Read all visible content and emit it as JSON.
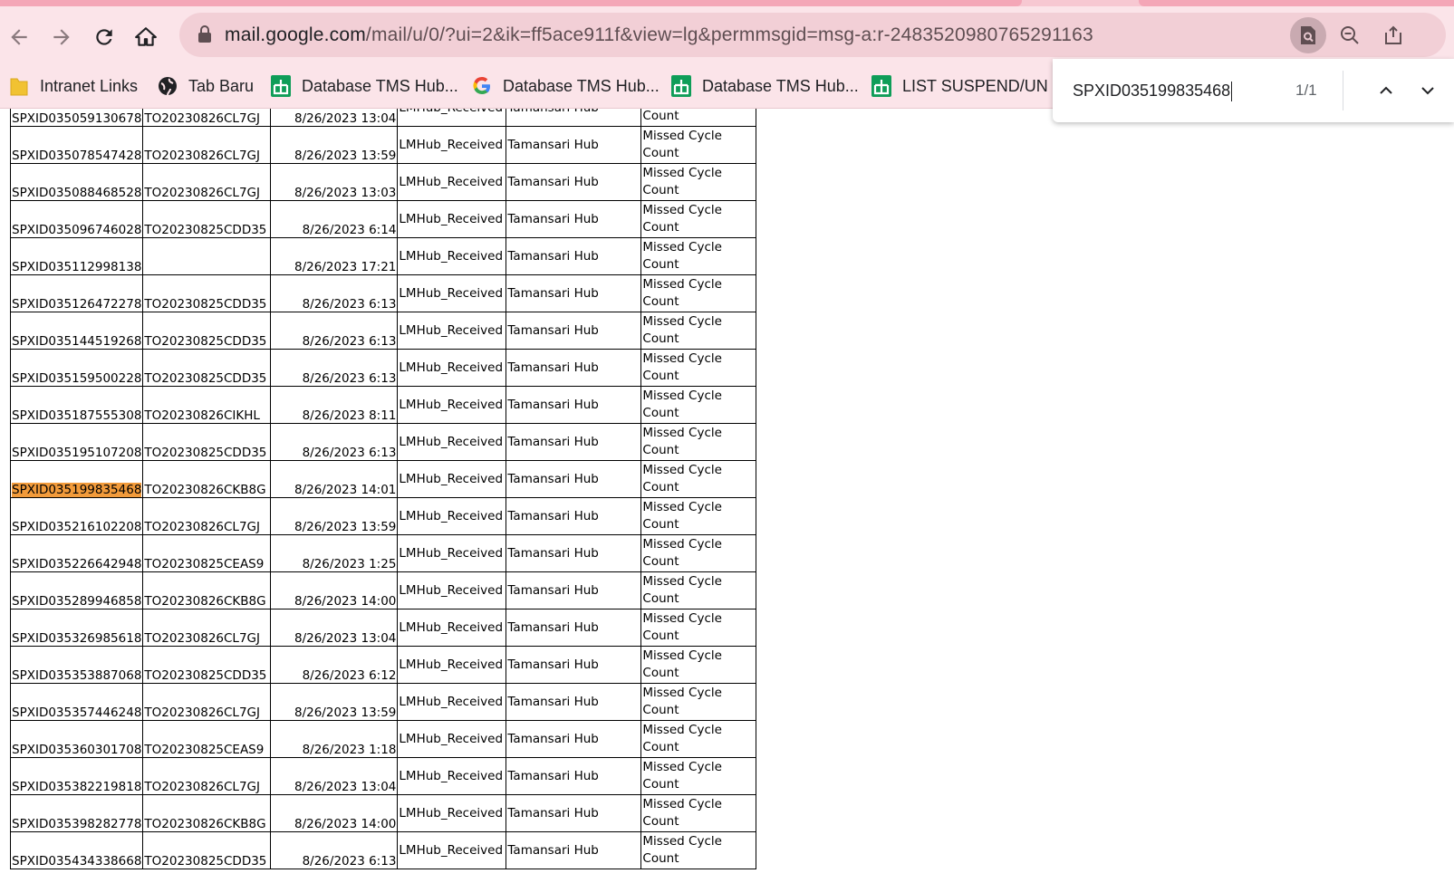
{
  "browser": {
    "url_host": "mail.google.com",
    "url_path": "/mail/u/0/?ui=2&ik=ff5ace911f&view=lg&permmsgid=msg-a:r-2483520980765291163",
    "bookmarks": [
      {
        "label": "Intranet Links",
        "icon": "folder-icon"
      },
      {
        "label": "Tab Baru",
        "icon": "globe-icon"
      },
      {
        "label": "Database TMS Hub...",
        "icon": "google-sheets-icon"
      },
      {
        "label": "Database TMS Hub...",
        "icon": "google-icon"
      },
      {
        "label": "Database TMS Hub...",
        "icon": "google-sheets-icon"
      },
      {
        "label": "LIST SUSPEND/UN",
        "icon": "google-sheets-icon"
      }
    ]
  },
  "find": {
    "query": "SPXID035199835468",
    "count": "1/1"
  },
  "table": {
    "rows": [
      {
        "id": "SPXID035059130678",
        "to": "TO20230826CL7GJ",
        "time": "8/26/2023 13:04",
        "status": "LMHub_Received",
        "hub": "Tamansari Hub",
        "reason": "Missed Cycle Count"
      },
      {
        "id": "SPXID035078547428",
        "to": "TO20230826CL7GJ",
        "time": "8/26/2023 13:59",
        "status": "LMHub_Received",
        "hub": "Tamansari Hub",
        "reason": "Missed Cycle Count"
      },
      {
        "id": "SPXID035088468528",
        "to": "TO20230826CL7GJ",
        "time": "8/26/2023 13:03",
        "status": "LMHub_Received",
        "hub": "Tamansari Hub",
        "reason": "Missed Cycle Count"
      },
      {
        "id": "SPXID035096746028",
        "to": "TO20230825CDD35",
        "time": "8/26/2023 6:14",
        "status": "LMHub_Received",
        "hub": "Tamansari Hub",
        "reason": "Missed Cycle Count"
      },
      {
        "id": "SPXID035112998138",
        "to": "",
        "time": "8/26/2023 17:21",
        "status": "LMHub_Received",
        "hub": "Tamansari Hub",
        "reason": "Missed Cycle Count"
      },
      {
        "id": "SPXID035126472278",
        "to": "TO20230825CDD35",
        "time": "8/26/2023 6:13",
        "status": "LMHub_Received",
        "hub": "Tamansari Hub",
        "reason": "Missed Cycle Count"
      },
      {
        "id": "SPXID035144519268",
        "to": "TO20230825CDD35",
        "time": "8/26/2023 6:13",
        "status": "LMHub_Received",
        "hub": "Tamansari Hub",
        "reason": "Missed Cycle Count"
      },
      {
        "id": "SPXID035159500228",
        "to": "TO20230825CDD35",
        "time": "8/26/2023 6:13",
        "status": "LMHub_Received",
        "hub": "Tamansari Hub",
        "reason": "Missed Cycle Count"
      },
      {
        "id": "SPXID035187555308",
        "to": "TO20230826CIKHL",
        "time": "8/26/2023 8:11",
        "status": "LMHub_Received",
        "hub": "Tamansari Hub",
        "reason": "Missed Cycle Count"
      },
      {
        "id": "SPXID035195107208",
        "to": "TO20230825CDD35",
        "time": "8/26/2023 6:13",
        "status": "LMHub_Received",
        "hub": "Tamansari Hub",
        "reason": "Missed Cycle Count"
      },
      {
        "id": "SPXID035199835468",
        "to": "TO20230826CKB8G",
        "time": "8/26/2023 14:01",
        "status": "LMHub_Received",
        "hub": "Tamansari Hub",
        "reason": "Missed Cycle Count",
        "highlighted": true
      },
      {
        "id": "SPXID035216102208",
        "to": "TO20230826CL7GJ",
        "time": "8/26/2023 13:59",
        "status": "LMHub_Received",
        "hub": "Tamansari Hub",
        "reason": "Missed Cycle Count"
      },
      {
        "id": "SPXID035226642948",
        "to": "TO20230825CEAS9",
        "time": "8/26/2023 1:25",
        "status": "LMHub_Received",
        "hub": "Tamansari Hub",
        "reason": "Missed Cycle Count"
      },
      {
        "id": "SPXID035289946858",
        "to": "TO20230826CKB8G",
        "time": "8/26/2023 14:00",
        "status": "LMHub_Received",
        "hub": "Tamansari Hub",
        "reason": "Missed Cycle Count"
      },
      {
        "id": "SPXID035326985618",
        "to": "TO20230826CL7GJ",
        "time": "8/26/2023 13:04",
        "status": "LMHub_Received",
        "hub": "Tamansari Hub",
        "reason": "Missed Cycle Count"
      },
      {
        "id": "SPXID035353887068",
        "to": "TO20230825CDD35",
        "time": "8/26/2023 6:12",
        "status": "LMHub_Received",
        "hub": "Tamansari Hub",
        "reason": "Missed Cycle Count"
      },
      {
        "id": "SPXID035357446248",
        "to": "TO20230826CL7GJ",
        "time": "8/26/2023 13:59",
        "status": "LMHub_Received",
        "hub": "Tamansari Hub",
        "reason": "Missed Cycle Count"
      },
      {
        "id": "SPXID035360301708",
        "to": "TO20230825CEAS9",
        "time": "8/26/2023 1:18",
        "status": "LMHub_Received",
        "hub": "Tamansari Hub",
        "reason": "Missed Cycle Count"
      },
      {
        "id": "SPXID035382219818",
        "to": "TO20230826CL7GJ",
        "time": "8/26/2023 13:04",
        "status": "LMHub_Received",
        "hub": "Tamansari Hub",
        "reason": "Missed Cycle Count"
      },
      {
        "id": "SPXID035398282778",
        "to": "TO20230826CKB8G",
        "time": "8/26/2023 14:00",
        "status": "LMHub_Received",
        "hub": "Tamansari Hub",
        "reason": "Missed Cycle Count"
      },
      {
        "id": "SPXID035434338668",
        "to": "TO20230825CDD35",
        "time": "8/26/2023 6:13",
        "status": "LMHub_Received",
        "hub": "Tamansari Hub",
        "reason": "Missed Cycle Count"
      }
    ]
  }
}
